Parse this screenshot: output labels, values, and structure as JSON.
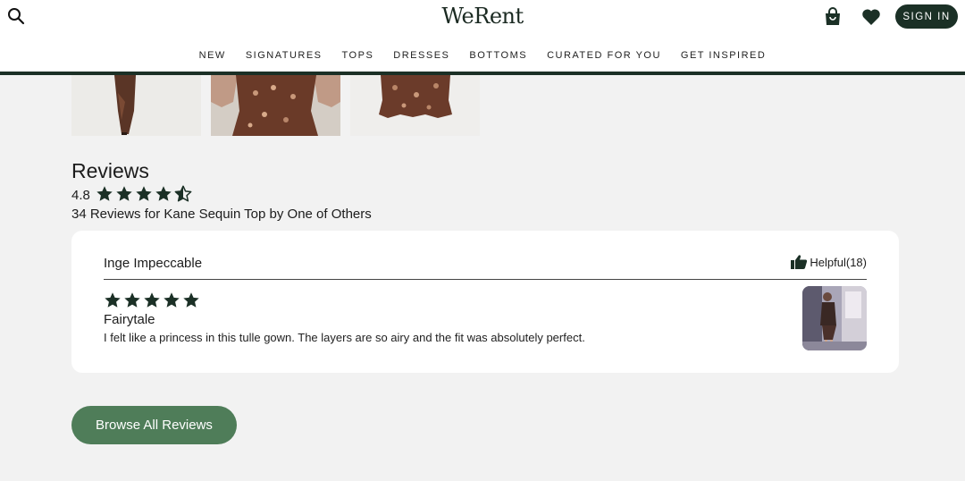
{
  "header": {
    "logo": "WeRent",
    "search_icon": "search-icon",
    "cart_icon": "shopping-bag-icon",
    "wishlist_icon": "heart-icon",
    "sign_in_label": "SIGN IN"
  },
  "nav": {
    "items": [
      {
        "label": "NEW"
      },
      {
        "label": "SIGNATURES"
      },
      {
        "label": "TOPS"
      },
      {
        "label": "DRESSES"
      },
      {
        "label": "BOTTOMS"
      },
      {
        "label": "CURATED FOR YOU"
      },
      {
        "label": "GET INSPIRED"
      }
    ]
  },
  "reviews": {
    "heading": "Reviews",
    "average_rating": "4.8",
    "average_stars": 4.5,
    "count_text": "34 Reviews for Kane Sequin Top by One of Others",
    "items": [
      {
        "reviewer": "Inge Impeccable",
        "helpful_label": "Helpful(18)",
        "stars": 5,
        "title": "Fairytale",
        "body": "I felt like a princess in this tulle gown. The layers are so airy and the fit was absolutely perfect."
      }
    ],
    "browse_label": "Browse All Reviews"
  },
  "colors": {
    "brand_dark": "#1b3026",
    "star": "#1b3026",
    "browse_button": "#4f7d59",
    "background": "#f2f2f2"
  }
}
